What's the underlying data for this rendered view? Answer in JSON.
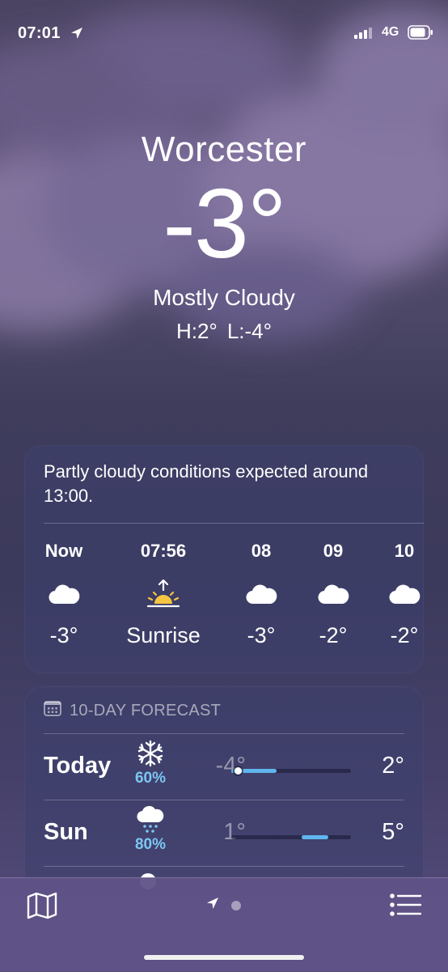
{
  "status_bar": {
    "time": "07:01",
    "network": "4G",
    "icons": [
      "location-arrow-icon",
      "signal-bars-icon",
      "battery-icon"
    ]
  },
  "current": {
    "city": "Worcester",
    "temperature": "-3°",
    "condition": "Mostly Cloudy",
    "high": "H:2°",
    "low": "L:-4°"
  },
  "hourly": {
    "summary": "Partly cloudy conditions expected around 13:00.",
    "items": [
      {
        "label": "Now",
        "icon": "cloud-icon",
        "value": "-3°"
      },
      {
        "label": "07:56",
        "icon": "sunrise-icon",
        "value": "Sunrise"
      },
      {
        "label": "08",
        "icon": "cloud-icon",
        "value": "-3°"
      },
      {
        "label": "09",
        "icon": "cloud-icon",
        "value": "-2°"
      },
      {
        "label": "10",
        "icon": "cloud-icon",
        "value": "-2°"
      }
    ]
  },
  "daily": {
    "header": "10-DAY FORECAST",
    "header_icon": "calendar-icon",
    "rows": [
      {
        "day": "Today",
        "icon": "snowflake-icon",
        "precip": "60%",
        "low": "-4°",
        "high": "2°",
        "range_start": 0.0,
        "range_end": 0.38,
        "current_marker": 0.03
      },
      {
        "day": "Sun",
        "icon": "cloud-rain-icon",
        "precip": "80%",
        "low": "1°",
        "high": "5°",
        "range_start": 0.59,
        "range_end": 0.81
      }
    ]
  },
  "toolbar": {
    "left_icon": "map-icon",
    "right_icon": "list-icon",
    "page_indicator": [
      "location-arrow-icon",
      "page-dot"
    ]
  },
  "colors": {
    "accent_blue": "#5fb6ee",
    "precip_blue": "#7cc6f2",
    "sun_yellow": "#f5c542"
  }
}
